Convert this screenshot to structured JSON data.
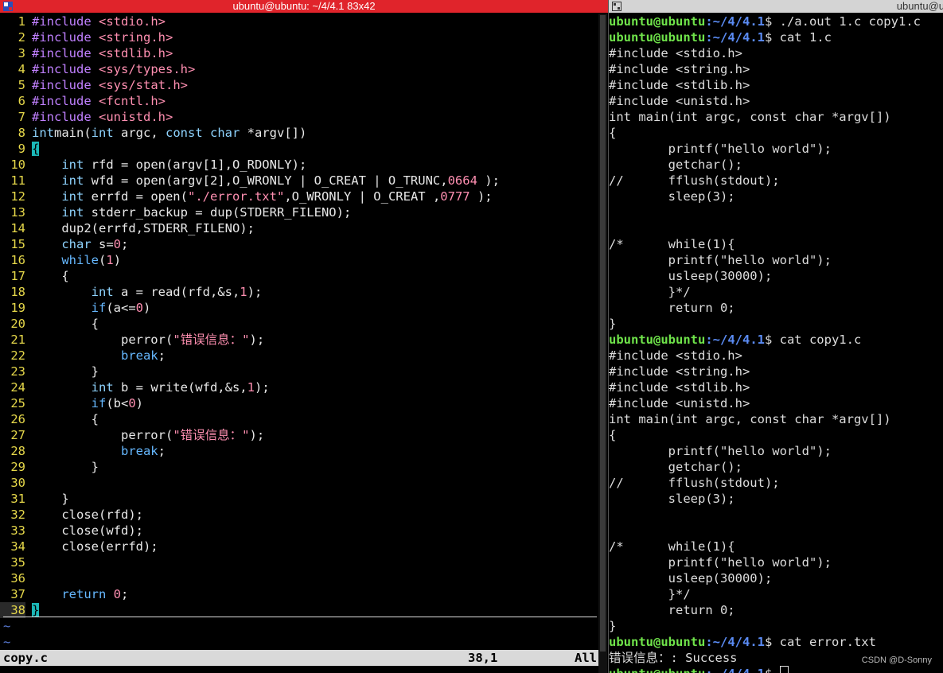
{
  "left_window": {
    "title": "ubuntu@ubuntu: ~/4/4.1 83x42",
    "icon": "terminal-icon",
    "code_lines": [
      [
        [
          "pp",
          "#include "
        ],
        [
          "str",
          "<stdio.h>"
        ]
      ],
      [
        [
          "pp",
          "#include "
        ],
        [
          "str",
          "<string.h>"
        ]
      ],
      [
        [
          "pp",
          "#include "
        ],
        [
          "str",
          "<stdlib.h>"
        ]
      ],
      [
        [
          "pp",
          "#include "
        ],
        [
          "str",
          "<sys/types.h>"
        ]
      ],
      [
        [
          "pp",
          "#include "
        ],
        [
          "str",
          "<sys/stat.h>"
        ]
      ],
      [
        [
          "pp",
          "#include "
        ],
        [
          "str",
          "<fcntl.h>"
        ]
      ],
      [
        [
          "pp",
          "#include "
        ],
        [
          "str",
          "<unistd.h>"
        ]
      ],
      [
        [
          "ty",
          "int"
        ],
        [
          "",
          "main("
        ],
        [
          "ty",
          "int"
        ],
        [
          "",
          " argc, "
        ],
        [
          "ty",
          "const char"
        ],
        [
          "",
          " *argv[])"
        ]
      ],
      [
        [
          "brace-cur",
          "{"
        ]
      ],
      [
        [
          "",
          "    "
        ],
        [
          "ty",
          "int"
        ],
        [
          "",
          " rfd = open(argv[1],O_RDONLY);"
        ]
      ],
      [
        [
          "",
          "    "
        ],
        [
          "ty",
          "int"
        ],
        [
          "",
          " wfd = open(argv[2],O_WRONLY | O_CREAT | O_TRUNC,"
        ],
        [
          "num",
          "0664"
        ],
        [
          "",
          " );"
        ]
      ],
      [
        [
          "",
          "    "
        ],
        [
          "ty",
          "int"
        ],
        [
          "",
          " errfd = open("
        ],
        [
          "str",
          "\"./error.txt\""
        ],
        [
          "",
          ",O_WRONLY | O_CREAT ,"
        ],
        [
          "num",
          "0777"
        ],
        [
          "",
          " );"
        ]
      ],
      [
        [
          "",
          "    "
        ],
        [
          "ty",
          "int"
        ],
        [
          "",
          " stderr_backup = dup(STDERR_FILENO);"
        ]
      ],
      [
        [
          "",
          "    dup2(errfd,STDERR_FILENO);"
        ]
      ],
      [
        [
          "",
          "    "
        ],
        [
          "ty",
          "char"
        ],
        [
          "",
          " s="
        ],
        [
          "num",
          "0"
        ],
        [
          "",
          ";"
        ]
      ],
      [
        [
          "",
          "    "
        ],
        [
          "kw",
          "while"
        ],
        [
          "",
          "("
        ],
        [
          "num",
          "1"
        ],
        [
          "",
          ")"
        ]
      ],
      [
        [
          "",
          "    {"
        ]
      ],
      [
        [
          "",
          "        "
        ],
        [
          "ty",
          "int"
        ],
        [
          "",
          " a = read(rfd,&s,"
        ],
        [
          "num",
          "1"
        ],
        [
          "",
          ");"
        ]
      ],
      [
        [
          "",
          "        "
        ],
        [
          "kw",
          "if"
        ],
        [
          "",
          "(a<="
        ],
        [
          "num",
          "0"
        ],
        [
          "",
          ")"
        ]
      ],
      [
        [
          "",
          "        {"
        ]
      ],
      [
        [
          "",
          "            perror("
        ],
        [
          "str",
          "\"错误信息：\""
        ],
        [
          "",
          ");"
        ]
      ],
      [
        [
          "",
          "            "
        ],
        [
          "kw",
          "break"
        ],
        [
          "",
          ";"
        ]
      ],
      [
        [
          "",
          "        }"
        ]
      ],
      [
        [
          "",
          "        "
        ],
        [
          "ty",
          "int"
        ],
        [
          "",
          " b = write(wfd,&s,"
        ],
        [
          "num",
          "1"
        ],
        [
          "",
          ");"
        ]
      ],
      [
        [
          "",
          "        "
        ],
        [
          "kw",
          "if"
        ],
        [
          "",
          "(b<"
        ],
        [
          "num",
          "0"
        ],
        [
          "",
          ")"
        ]
      ],
      [
        [
          "",
          "        {"
        ]
      ],
      [
        [
          "",
          "            perror("
        ],
        [
          "str",
          "\"错误信息：\""
        ],
        [
          "",
          ");"
        ]
      ],
      [
        [
          "",
          "            "
        ],
        [
          "kw",
          "break"
        ],
        [
          "",
          ";"
        ]
      ],
      [
        [
          "",
          "        }"
        ]
      ],
      [
        [
          "",
          ""
        ]
      ],
      [
        [
          "",
          "    }"
        ]
      ],
      [
        [
          "",
          "    close(rfd);"
        ]
      ],
      [
        [
          "",
          "    close(wfd);"
        ]
      ],
      [
        [
          "",
          "    close(errfd);"
        ]
      ],
      [
        [
          "",
          ""
        ]
      ],
      [
        [
          "",
          ""
        ]
      ],
      [
        [
          "",
          "    "
        ],
        [
          "kw",
          "return"
        ],
        [
          "",
          " "
        ],
        [
          "num",
          "0"
        ],
        [
          "",
          ";"
        ]
      ],
      [
        [
          "cursor",
          "}"
        ]
      ]
    ],
    "tildes": [
      "~",
      "~"
    ],
    "status": {
      "filename": "copy.c",
      "position": "38,1",
      "percent": "All"
    }
  },
  "right_window": {
    "title": "ubuntu@u",
    "icon": "terminal-icon",
    "lines": [
      {
        "prompt": "ubuntu@ubuntu",
        "path": ":~/4/4.1",
        "cmd": "$ ./a.out 1.c copy1.c"
      },
      {
        "prompt": "ubuntu@ubuntu",
        "path": ":~/4/4.1",
        "cmd": "$ cat 1.c"
      },
      {
        "text": "#include <stdio.h>"
      },
      {
        "text": "#include <string.h>"
      },
      {
        "text": "#include <stdlib.h>"
      },
      {
        "text": "#include <unistd.h>"
      },
      {
        "text": "int main(int argc, const char *argv[])"
      },
      {
        "text": "{"
      },
      {
        "text": "        printf(\"hello world\");"
      },
      {
        "text": "        getchar();"
      },
      {
        "text": "//      fflush(stdout);"
      },
      {
        "text": "        sleep(3);"
      },
      {
        "text": ""
      },
      {
        "text": ""
      },
      {
        "text": "/*      while(1){"
      },
      {
        "text": "        printf(\"hello world\");"
      },
      {
        "text": "        usleep(30000);"
      },
      {
        "text": "        }*/"
      },
      {
        "text": "        return 0;"
      },
      {
        "text": "}"
      },
      {
        "prompt": "ubuntu@ubuntu",
        "path": ":~/4/4.1",
        "cmd": "$ cat copy1.c"
      },
      {
        "text": "#include <stdio.h>"
      },
      {
        "text": "#include <string.h>"
      },
      {
        "text": "#include <stdlib.h>"
      },
      {
        "text": "#include <unistd.h>"
      },
      {
        "text": "int main(int argc, const char *argv[])"
      },
      {
        "text": "{"
      },
      {
        "text": "        printf(\"hello world\");"
      },
      {
        "text": "        getchar();"
      },
      {
        "text": "//      fflush(stdout);"
      },
      {
        "text": "        sleep(3);"
      },
      {
        "text": ""
      },
      {
        "text": ""
      },
      {
        "text": "/*      while(1){"
      },
      {
        "text": "        printf(\"hello world\");"
      },
      {
        "text": "        usleep(30000);"
      },
      {
        "text": "        }*/"
      },
      {
        "text": "        return 0;"
      },
      {
        "text": "}"
      },
      {
        "prompt": "ubuntu@ubuntu",
        "path": ":~/4/4.1",
        "cmd": "$ cat error.txt"
      },
      {
        "text": "错误信息：: Success"
      },
      {
        "prompt": "ubuntu@ubuntu",
        "path": ":~/4/4.1",
        "cmd": "$ ",
        "cursor": true
      }
    ]
  },
  "watermark": "CSDN @D-Sonny"
}
